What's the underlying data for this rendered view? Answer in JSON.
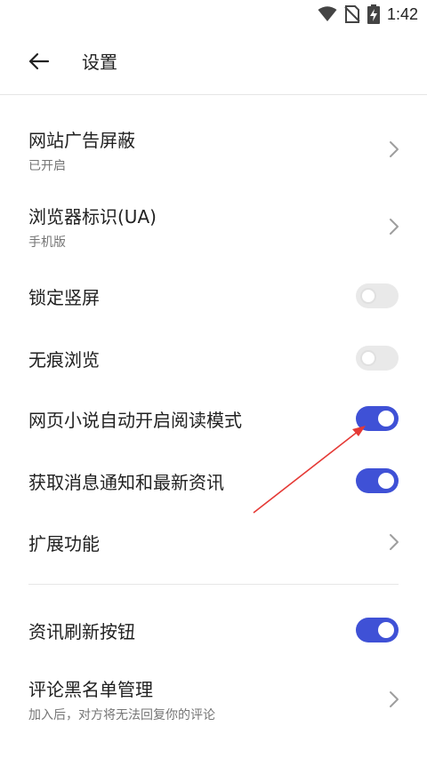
{
  "status_bar": {
    "time": "1:42",
    "icons": [
      "wifi-icon",
      "no-sim-icon",
      "battery-charging-icon"
    ]
  },
  "header": {
    "back_icon": "arrow-left-icon",
    "title": "设置"
  },
  "settings": {
    "ad_block": {
      "title": "网站广告屏蔽",
      "subtitle": "已开启"
    },
    "user_agent": {
      "title": "浏览器标识(UA)",
      "subtitle": "手机版"
    },
    "lock_portrait": {
      "title": "锁定竖屏",
      "enabled": false
    },
    "incognito": {
      "title": "无痕浏览",
      "enabled": false
    },
    "novel_reading_mode": {
      "title": "网页小说自动开启阅读模式",
      "enabled": true
    },
    "news_notifications": {
      "title": "获取消息通知和最新资讯",
      "enabled": true
    },
    "extensions": {
      "title": "扩展功能"
    },
    "news_refresh_button": {
      "title": "资讯刷新按钮",
      "enabled": true
    },
    "comment_blacklist": {
      "title": "评论黑名单管理",
      "subtitle": "加入后，对方将无法回复你的评论"
    }
  },
  "colors": {
    "toggle_on": "#3f51d6",
    "toggle_off": "#e9e9e9",
    "annotation_arrow": "#e53935"
  }
}
